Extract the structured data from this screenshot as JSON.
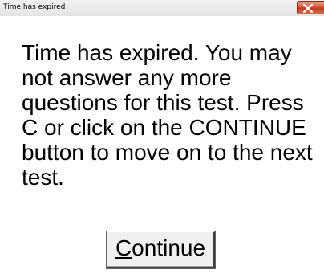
{
  "window": {
    "title": "Time has expired"
  },
  "dialog": {
    "message": "Time has expired. You may not answer any more questions for this test. Press C or click on the CONTINUE button to move on to the next test.",
    "continue_mnemonic": "C",
    "continue_rest": "ontinue"
  },
  "icons": {
    "close": "close-icon"
  },
  "colors": {
    "close_button": "#c2381c",
    "title_bar": "#e8e8e8",
    "background": "#ffffff"
  }
}
